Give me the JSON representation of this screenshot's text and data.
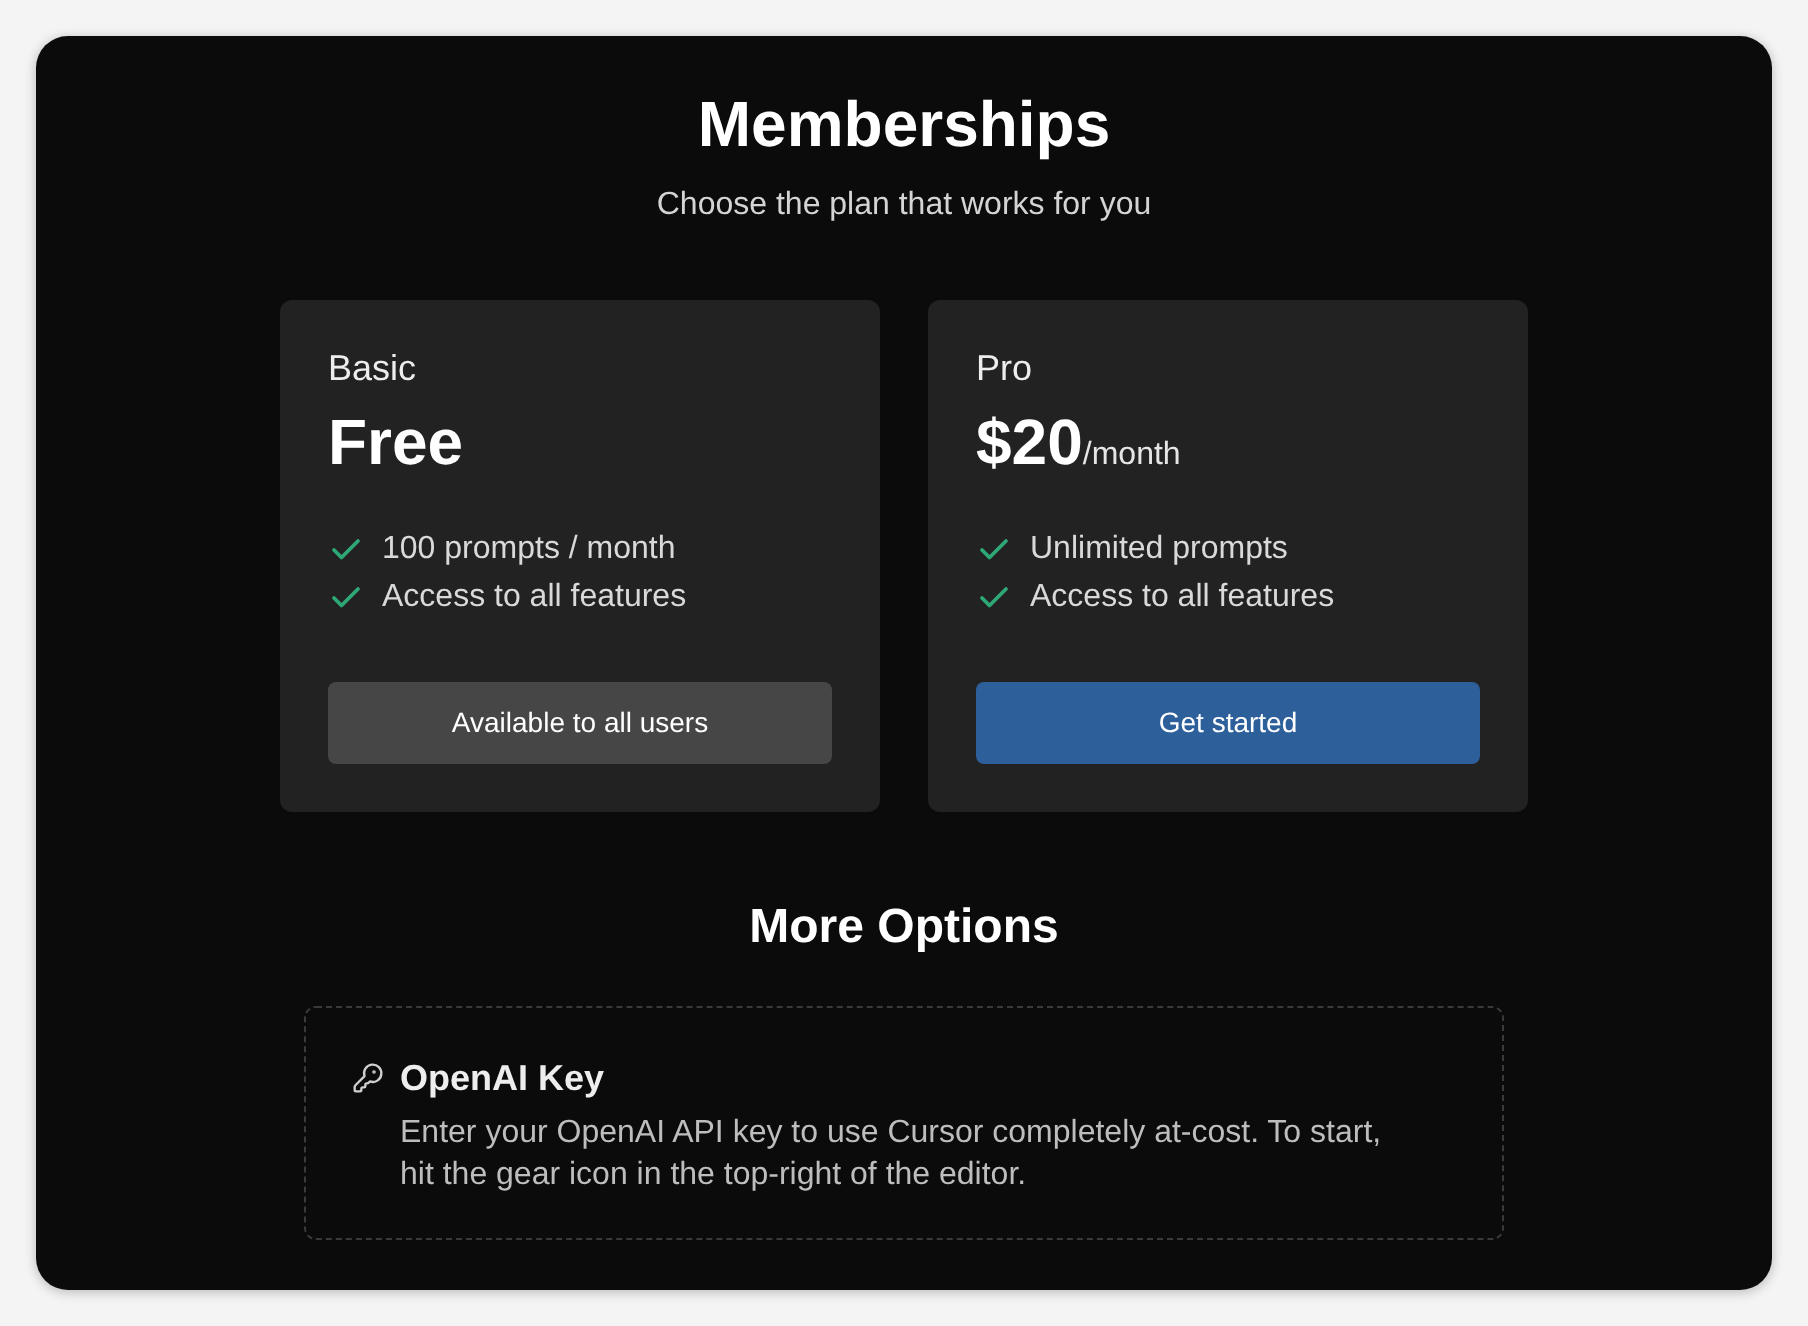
{
  "header": {
    "title": "Memberships",
    "subtitle": "Choose the plan that works for you"
  },
  "plans": [
    {
      "name": "Basic",
      "price": "Free",
      "features": [
        "100 prompts / month",
        "Access to all features"
      ],
      "button": {
        "label": "Available to all users",
        "kind": "secondary"
      }
    },
    {
      "name": "Pro",
      "price": "$20",
      "period": "/month",
      "features": [
        "Unlimited prompts",
        "Access to all features"
      ],
      "button": {
        "label": "Get started",
        "kind": "primary"
      }
    }
  ],
  "more_options": {
    "title": "More Options",
    "items": [
      {
        "title": "OpenAI Key",
        "description": "Enter your OpenAI API key to use Cursor completely at-cost. To start, hit the gear icon in the top-right of the editor."
      }
    ]
  }
}
